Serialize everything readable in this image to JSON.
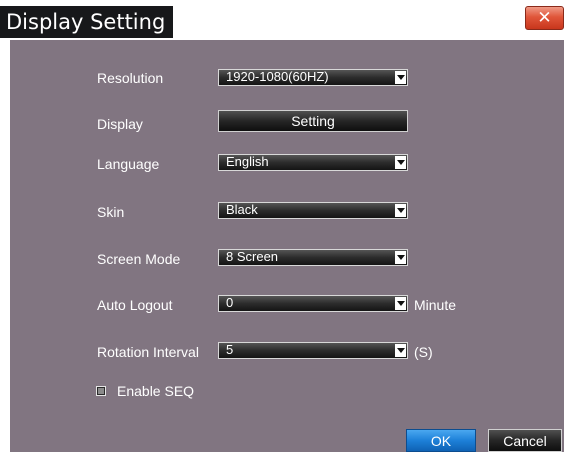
{
  "window": {
    "title": "Display Setting",
    "close_glyph": "✕"
  },
  "settings": {
    "resolution": {
      "label": "Resolution",
      "value": "1920-1080(60HZ)"
    },
    "display": {
      "label": "Display",
      "button_label": "Setting"
    },
    "language": {
      "label": "Language",
      "value": "English"
    },
    "skin": {
      "label": "Skin",
      "value": "Black"
    },
    "screen_mode": {
      "label": "Screen Mode",
      "value": "8 Screen"
    },
    "auto_logout": {
      "label": "Auto Logout",
      "value": "0",
      "unit": "Minute"
    },
    "rotation_interval": {
      "label": "Rotation Interval",
      "value": "5",
      "unit": "(S)"
    },
    "enable_seq": {
      "label": "Enable SEQ",
      "checked": false
    }
  },
  "footer": {
    "ok_label": "OK",
    "cancel_label": "Cancel"
  },
  "colors": {
    "panel_background": "#817581",
    "title_background": "#17181a",
    "close_button": "#e0563a",
    "ok_button": "#1d80d8"
  }
}
